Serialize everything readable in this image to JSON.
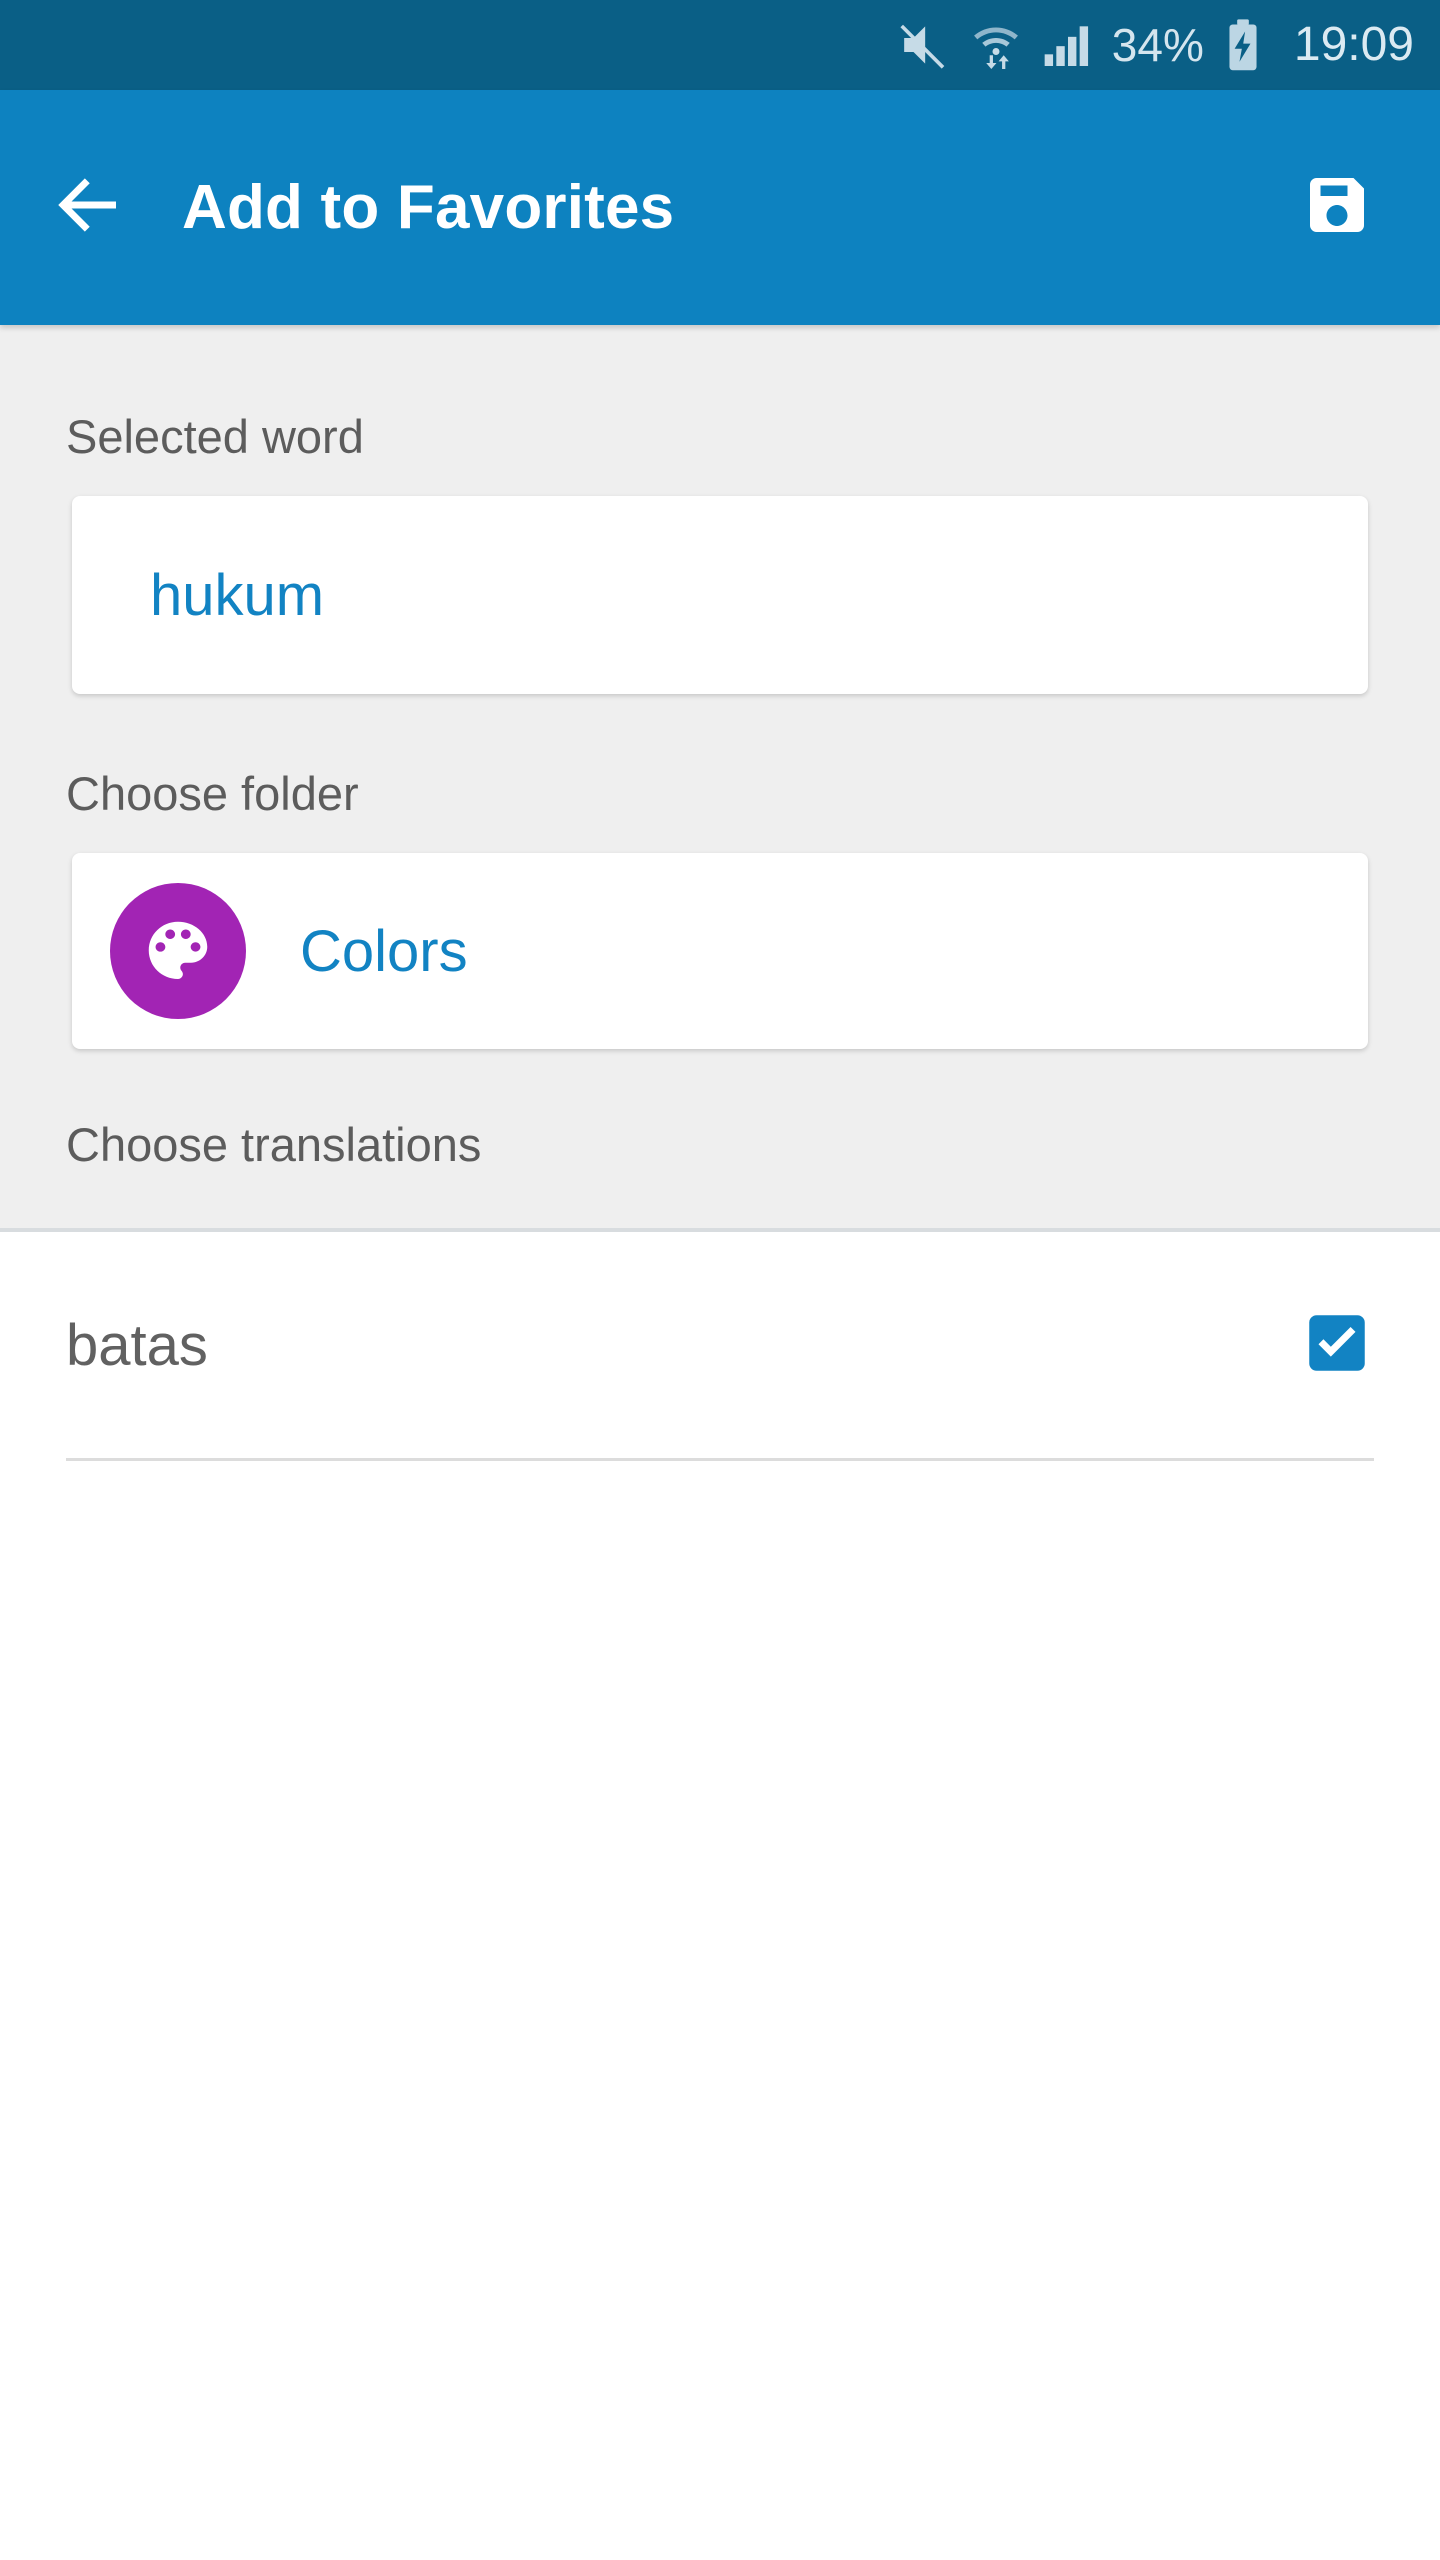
{
  "status_bar": {
    "battery_percent": "34%",
    "time": "19:09",
    "icons": [
      "mute-icon",
      "wifi-icon",
      "signal-icon",
      "battery-charging-icon"
    ],
    "background_color": "#0a5f86",
    "foreground_color": "#d4e5ee"
  },
  "app_bar": {
    "title": "Add to Favorites",
    "back_icon": "arrow-left-icon",
    "save_icon": "floppy-disk-save-icon",
    "background_color": "#0d82c0",
    "text_color": "#ffffff"
  },
  "sections": {
    "selected_word": {
      "label": "Selected word",
      "value": "hukum",
      "value_color": "#1283c3"
    },
    "choose_folder": {
      "label": "Choose folder",
      "folder_name": "Colors",
      "folder_icon": "palette-icon",
      "folder_icon_color": "#a224b4",
      "name_color": "#1283c3"
    },
    "choose_translations": {
      "label": "Choose translations",
      "items": [
        {
          "text": "batas",
          "checked": true
        }
      ]
    }
  },
  "colors": {
    "accent": "#0d82c0",
    "checkbox_checked": "#1283c3",
    "page_background": "#efefef",
    "list_background": "#ffffff",
    "label_text": "#5c5c5c",
    "item_text": "#616161",
    "divider": "#dcdcdc"
  }
}
